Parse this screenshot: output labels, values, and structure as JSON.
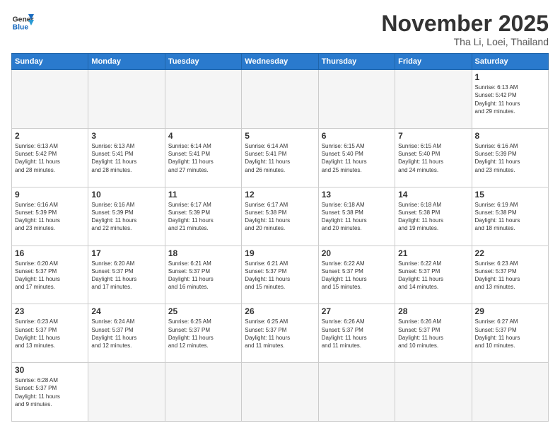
{
  "logo": {
    "line1": "General",
    "line2": "Blue"
  },
  "header": {
    "month": "November 2025",
    "location": "Tha Li, Loei, Thailand"
  },
  "weekdays": [
    "Sunday",
    "Monday",
    "Tuesday",
    "Wednesday",
    "Thursday",
    "Friday",
    "Saturday"
  ],
  "days": [
    {
      "num": "",
      "info": ""
    },
    {
      "num": "",
      "info": ""
    },
    {
      "num": "",
      "info": ""
    },
    {
      "num": "",
      "info": ""
    },
    {
      "num": "",
      "info": ""
    },
    {
      "num": "",
      "info": ""
    },
    {
      "num": "1",
      "info": "Sunrise: 6:13 AM\nSunset: 5:42 PM\nDaylight: 11 hours\nand 29 minutes."
    },
    {
      "num": "2",
      "info": "Sunrise: 6:13 AM\nSunset: 5:42 PM\nDaylight: 11 hours\nand 28 minutes."
    },
    {
      "num": "3",
      "info": "Sunrise: 6:13 AM\nSunset: 5:41 PM\nDaylight: 11 hours\nand 28 minutes."
    },
    {
      "num": "4",
      "info": "Sunrise: 6:14 AM\nSunset: 5:41 PM\nDaylight: 11 hours\nand 27 minutes."
    },
    {
      "num": "5",
      "info": "Sunrise: 6:14 AM\nSunset: 5:41 PM\nDaylight: 11 hours\nand 26 minutes."
    },
    {
      "num": "6",
      "info": "Sunrise: 6:15 AM\nSunset: 5:40 PM\nDaylight: 11 hours\nand 25 minutes."
    },
    {
      "num": "7",
      "info": "Sunrise: 6:15 AM\nSunset: 5:40 PM\nDaylight: 11 hours\nand 24 minutes."
    },
    {
      "num": "8",
      "info": "Sunrise: 6:16 AM\nSunset: 5:39 PM\nDaylight: 11 hours\nand 23 minutes."
    },
    {
      "num": "9",
      "info": "Sunrise: 6:16 AM\nSunset: 5:39 PM\nDaylight: 11 hours\nand 23 minutes."
    },
    {
      "num": "10",
      "info": "Sunrise: 6:16 AM\nSunset: 5:39 PM\nDaylight: 11 hours\nand 22 minutes."
    },
    {
      "num": "11",
      "info": "Sunrise: 6:17 AM\nSunset: 5:39 PM\nDaylight: 11 hours\nand 21 minutes."
    },
    {
      "num": "12",
      "info": "Sunrise: 6:17 AM\nSunset: 5:38 PM\nDaylight: 11 hours\nand 20 minutes."
    },
    {
      "num": "13",
      "info": "Sunrise: 6:18 AM\nSunset: 5:38 PM\nDaylight: 11 hours\nand 20 minutes."
    },
    {
      "num": "14",
      "info": "Sunrise: 6:18 AM\nSunset: 5:38 PM\nDaylight: 11 hours\nand 19 minutes."
    },
    {
      "num": "15",
      "info": "Sunrise: 6:19 AM\nSunset: 5:38 PM\nDaylight: 11 hours\nand 18 minutes."
    },
    {
      "num": "16",
      "info": "Sunrise: 6:20 AM\nSunset: 5:37 PM\nDaylight: 11 hours\nand 17 minutes."
    },
    {
      "num": "17",
      "info": "Sunrise: 6:20 AM\nSunset: 5:37 PM\nDaylight: 11 hours\nand 17 minutes."
    },
    {
      "num": "18",
      "info": "Sunrise: 6:21 AM\nSunset: 5:37 PM\nDaylight: 11 hours\nand 16 minutes."
    },
    {
      "num": "19",
      "info": "Sunrise: 6:21 AM\nSunset: 5:37 PM\nDaylight: 11 hours\nand 15 minutes."
    },
    {
      "num": "20",
      "info": "Sunrise: 6:22 AM\nSunset: 5:37 PM\nDaylight: 11 hours\nand 15 minutes."
    },
    {
      "num": "21",
      "info": "Sunrise: 6:22 AM\nSunset: 5:37 PM\nDaylight: 11 hours\nand 14 minutes."
    },
    {
      "num": "22",
      "info": "Sunrise: 6:23 AM\nSunset: 5:37 PM\nDaylight: 11 hours\nand 13 minutes."
    },
    {
      "num": "23",
      "info": "Sunrise: 6:23 AM\nSunset: 5:37 PM\nDaylight: 11 hours\nand 13 minutes."
    },
    {
      "num": "24",
      "info": "Sunrise: 6:24 AM\nSunset: 5:37 PM\nDaylight: 11 hours\nand 12 minutes."
    },
    {
      "num": "25",
      "info": "Sunrise: 6:25 AM\nSunset: 5:37 PM\nDaylight: 11 hours\nand 12 minutes."
    },
    {
      "num": "26",
      "info": "Sunrise: 6:25 AM\nSunset: 5:37 PM\nDaylight: 11 hours\nand 11 minutes."
    },
    {
      "num": "27",
      "info": "Sunrise: 6:26 AM\nSunset: 5:37 PM\nDaylight: 11 hours\nand 11 minutes."
    },
    {
      "num": "28",
      "info": "Sunrise: 6:26 AM\nSunset: 5:37 PM\nDaylight: 11 hours\nand 10 minutes."
    },
    {
      "num": "29",
      "info": "Sunrise: 6:27 AM\nSunset: 5:37 PM\nDaylight: 11 hours\nand 10 minutes."
    },
    {
      "num": "30",
      "info": "Sunrise: 6:28 AM\nSunset: 5:37 PM\nDaylight: 11 hours\nand 9 minutes."
    },
    {
      "num": "",
      "info": ""
    },
    {
      "num": "",
      "info": ""
    },
    {
      "num": "",
      "info": ""
    },
    {
      "num": "",
      "info": ""
    },
    {
      "num": "",
      "info": ""
    },
    {
      "num": "",
      "info": ""
    }
  ]
}
